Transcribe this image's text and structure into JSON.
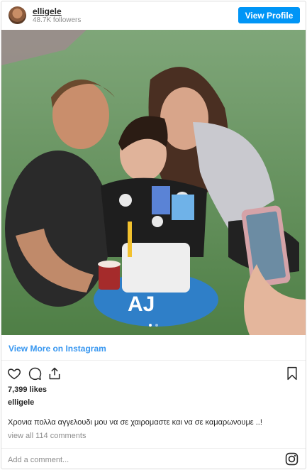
{
  "header": {
    "username": "elligele",
    "followers": "48.7K followers",
    "view_profile_label": "View Profile"
  },
  "post": {
    "cake_text": "AJ",
    "carousel": {
      "total": 2,
      "active": 1
    }
  },
  "view_more_label": "View More on Instagram",
  "likes": "7,399 likes",
  "caption_user": "elligele",
  "caption_text": "Χρονια πολλα αγγελουδι μου να σε χαιρομαστε και να σε καμαρωνουμε ..!",
  "comments_link": "view all 114 comments",
  "comment_placeholder": "Add a comment...",
  "colors": {
    "accent": "#0095f6",
    "link": "#3897f0",
    "muted": "#8e8e8e",
    "text": "#262626"
  },
  "icons": [
    "heart-icon",
    "comment-icon",
    "share-icon",
    "bookmark-icon",
    "instagram-icon"
  ]
}
